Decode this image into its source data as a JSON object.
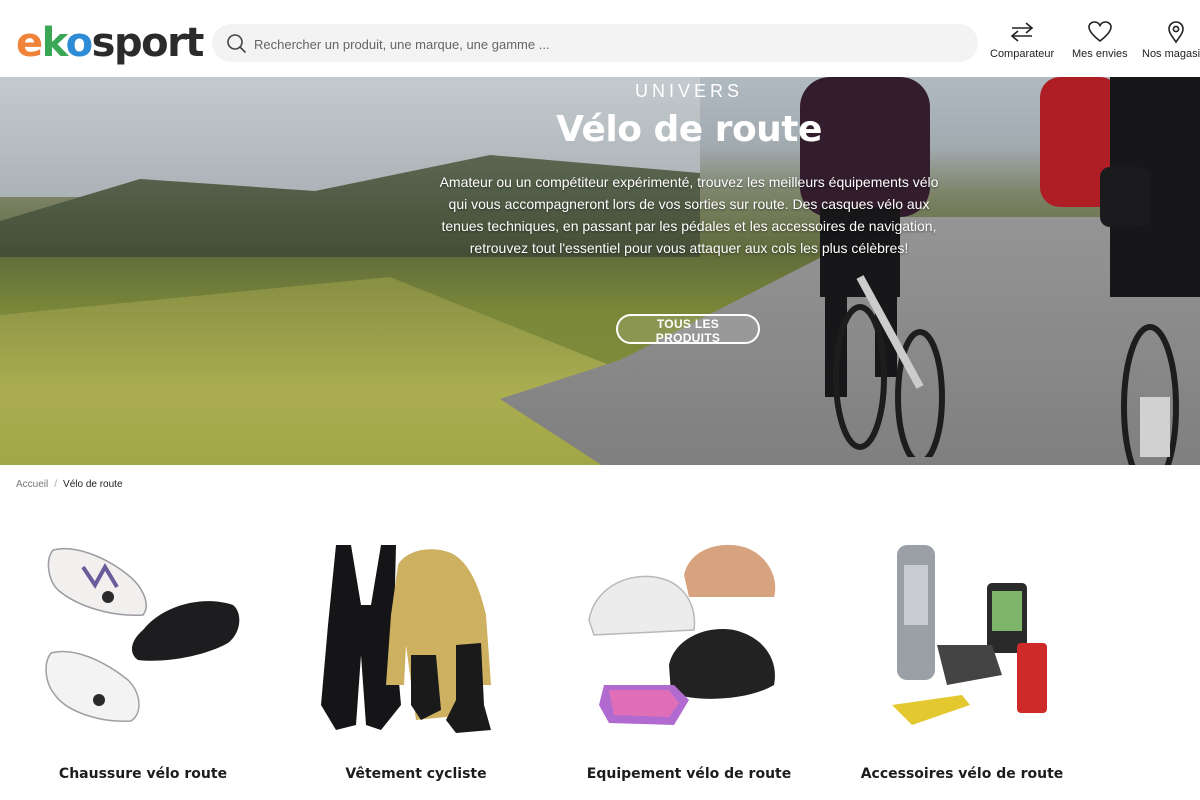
{
  "header": {
    "logo": {
      "e": "e",
      "k": "k",
      "o": "o",
      "rest": "sport"
    },
    "search_placeholder": "Rechercher un produit, une marque, une gamme ...",
    "comparateur_label": "Comparateur",
    "envies_label": "Mes envies",
    "magasins_label": "Nos magasins"
  },
  "hero": {
    "eyebrow": "UNIVERS",
    "title": "Vélo de route",
    "description": "Amateur ou un compétiteur expérimenté, trouvez les meilleurs équipements vélo qui vous accompagneront lors de vos sorties sur route. Des casques vélo aux tenues techniques, en passant par les pédales et les accessoires de navigation, retrouvez tout l'essentiel pour vous attaquer aux cols les plus célèbres!",
    "cta_label": "TOUS LES PRODUITS"
  },
  "breadcrumb": {
    "home": "Accueil",
    "separator": "/",
    "current": "Vélo de route"
  },
  "categories": [
    {
      "title": "Chaussure vélo route"
    },
    {
      "title": "Vêtement cycliste"
    },
    {
      "title": "Equipement vélo de route"
    },
    {
      "title": "Accessoires vélo de route"
    }
  ]
}
